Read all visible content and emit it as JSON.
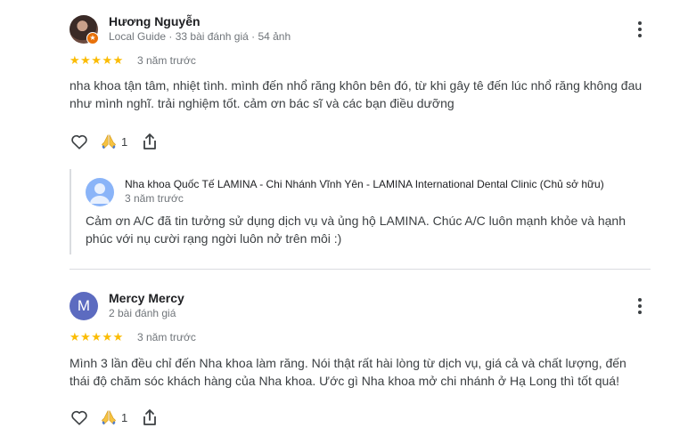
{
  "reviews": [
    {
      "author": "Hương Nguyễn",
      "meta": "Local Guide · 33 bài đánh giá · 54 ảnh",
      "stars": "★★★★★",
      "time": "3 năm trước",
      "text": "nha khoa tận tâm, nhiệt tình. mình đến nhổ răng khôn bên đó, từ khi gây tê đến lúc nhổ răng không đau như mình nghĩ. trải nghiệm tốt. cảm ơn bác sĩ và các bạn điều dưỡng",
      "likes_count": "1",
      "icons": {
        "like": "heart-outline-icon",
        "reaction": "praying-hands-icon",
        "share": "share-icon",
        "menu": "more-vertical-icon",
        "badge": "local-guide-star-icon"
      },
      "reply": {
        "owner": "Nha khoa Quốc Tế LAMINA - Chi Nhánh Vĩnh Yên - LAMINA International Dental Clinic (Chủ sở hữu)",
        "time": "3 năm trước",
        "text": "Cảm ơn A/C đã tin tưởng sử dụng dịch vụ và ủng hộ LAMINA. Chúc A/C luôn mạnh khỏe và hạnh phúc với nụ cười rạng ngời luôn nở trên môi :)"
      }
    },
    {
      "author": "Mercy Mercy",
      "avatar_letter": "M",
      "meta": "2 bài đánh giá",
      "stars": "★★★★★",
      "time": "3 năm trước",
      "text": "Mình 3 lần đều chỉ đến Nha khoa làm răng. Nói thật rất hài lòng từ dịch vụ, giá cả và chất lượng, đến thái độ chăm sóc khách hàng của Nha khoa. Ước gì Nha khoa mở chi nhánh ở Hạ Long thì tốt quá!",
      "likes_count": "1"
    }
  ],
  "colors": {
    "star": "#fbbc04",
    "local_guide_badge": "#e8710a",
    "avatar_letter_bg": "#5c6bc0",
    "owner_avatar_bg": "#8ab4f8",
    "divider": "#dadce0"
  }
}
